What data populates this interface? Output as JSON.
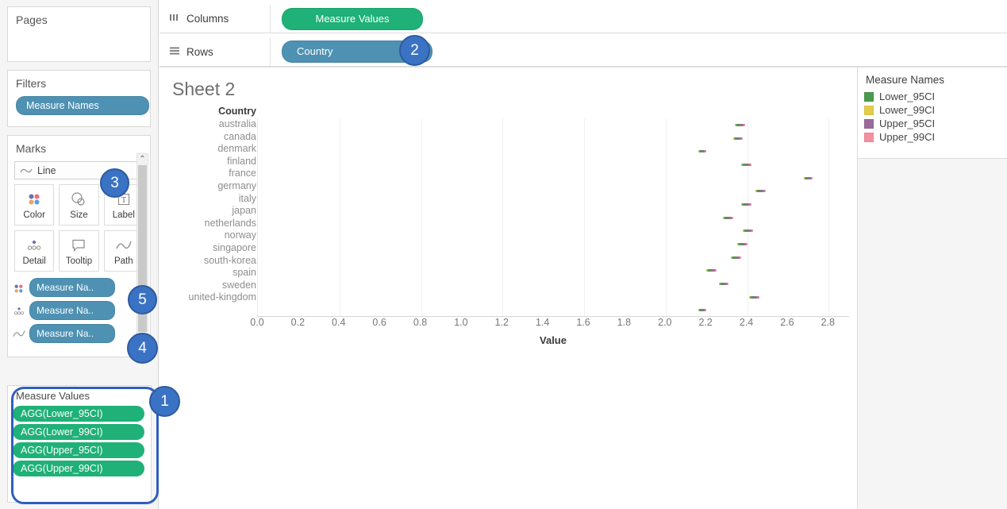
{
  "left_panel": {
    "pages": {
      "title": "Pages"
    },
    "filters": {
      "title": "Filters",
      "pill": "Measure Names"
    },
    "marks": {
      "title": "Marks",
      "mark_type": "Line",
      "mark_type_icon": "line-icon",
      "buttons": [
        {
          "label": "Color",
          "icon": "color-icon"
        },
        {
          "label": "Size",
          "icon": "size-icon"
        },
        {
          "label": "Label",
          "icon": "label-icon"
        },
        {
          "label": "Detail",
          "icon": "detail-icon"
        },
        {
          "label": "Tooltip",
          "icon": "tooltip-icon"
        },
        {
          "label": "Path",
          "icon": "path-icon"
        }
      ],
      "shelf_pills": [
        {
          "label": "Measure Na..",
          "icon": "color-icon"
        },
        {
          "label": "Measure Na..",
          "icon": "detail-icon"
        },
        {
          "label": "Measure Na..",
          "icon": "path-icon"
        }
      ],
      "scroll_up": "⌃",
      "scroll_down": "⌄"
    },
    "measure_values": {
      "title": "Measure Values",
      "pills": [
        "AGG(Lower_95CI)",
        "AGG(Lower_99CI)",
        "AGG(Upper_95CI)",
        "AGG(Upper_99CI)"
      ]
    }
  },
  "shelves": {
    "columns": {
      "label": "Columns",
      "icon": "columns-icon",
      "pill": "Measure Values"
    },
    "rows": {
      "label": "Rows",
      "icon": "rows-icon",
      "pill": "Country"
    }
  },
  "viz": {
    "sheet_title": "Sheet 2"
  },
  "legend": {
    "title": "Measure Names",
    "items": [
      {
        "label": "Lower_95CI",
        "color": "#4a9a4c"
      },
      {
        "label": "Lower_99CI",
        "color": "#e2cd4a"
      },
      {
        "label": "Upper_95CI",
        "color": "#9a6b9a"
      },
      {
        "label": "Upper_99CI",
        "color": "#f48fa2"
      }
    ]
  },
  "badges": [
    {
      "id": "badge-1",
      "label": "1"
    },
    {
      "id": "badge-2",
      "label": "2"
    },
    {
      "id": "badge-3",
      "label": "3"
    },
    {
      "id": "badge-4",
      "label": "4"
    },
    {
      "id": "badge-5",
      "label": "5"
    }
  ],
  "chart_data": {
    "type": "line",
    "title": "Sheet 2",
    "xlabel": "Value",
    "ylabel": "Country",
    "xlim": [
      0.0,
      2.9
    ],
    "xticks": [
      "0.0",
      "0.2",
      "0.4",
      "0.6",
      "0.8",
      "1.0",
      "1.2",
      "1.4",
      "1.6",
      "1.8",
      "2.0",
      "2.2",
      "2.4",
      "2.6",
      "2.8"
    ],
    "xtick_values": [
      0.0,
      0.2,
      0.4,
      0.6,
      0.8,
      1.0,
      1.2,
      1.4,
      1.6,
      1.8,
      2.0,
      2.2,
      2.4,
      2.6,
      2.8
    ],
    "grid": true,
    "gridline_values": [
      0.4,
      0.8,
      1.2,
      1.6,
      2.0,
      2.4,
      2.8
    ],
    "legend_position": "right",
    "categories": [
      "australia",
      "canada",
      "denmark",
      "finland",
      "france",
      "germany",
      "italy",
      "japan",
      "netherlands",
      "norway",
      "singapore",
      "south-korea",
      "spain",
      "sweden",
      "united-kingdom"
    ],
    "series": [
      {
        "name": "Lower_99CI",
        "color": "#e2cd4a",
        "values": [
          2.34,
          2.33,
          2.16,
          2.37,
          2.68,
          2.44,
          2.37,
          2.28,
          2.38,
          2.35,
          2.32,
          2.2,
          2.26,
          2.41,
          2.16
        ]
      },
      {
        "name": "Lower_95CI",
        "color": "#4a9a4c",
        "values": [
          2.35,
          2.34,
          2.17,
          2.38,
          2.69,
          2.45,
          2.38,
          2.29,
          2.39,
          2.36,
          2.33,
          2.21,
          2.27,
          2.42,
          2.17
        ]
      },
      {
        "name": "Upper_95CI",
        "color": "#9a6b9a",
        "values": [
          2.38,
          2.37,
          2.19,
          2.41,
          2.71,
          2.48,
          2.41,
          2.32,
          2.42,
          2.39,
          2.36,
          2.24,
          2.3,
          2.45,
          2.19
        ]
      },
      {
        "name": "Upper_99CI",
        "color": "#f48fa2",
        "values": [
          2.39,
          2.38,
          2.2,
          2.42,
          2.72,
          2.49,
          2.42,
          2.33,
          2.43,
          2.4,
          2.37,
          2.25,
          2.31,
          2.46,
          2.2
        ]
      }
    ]
  }
}
